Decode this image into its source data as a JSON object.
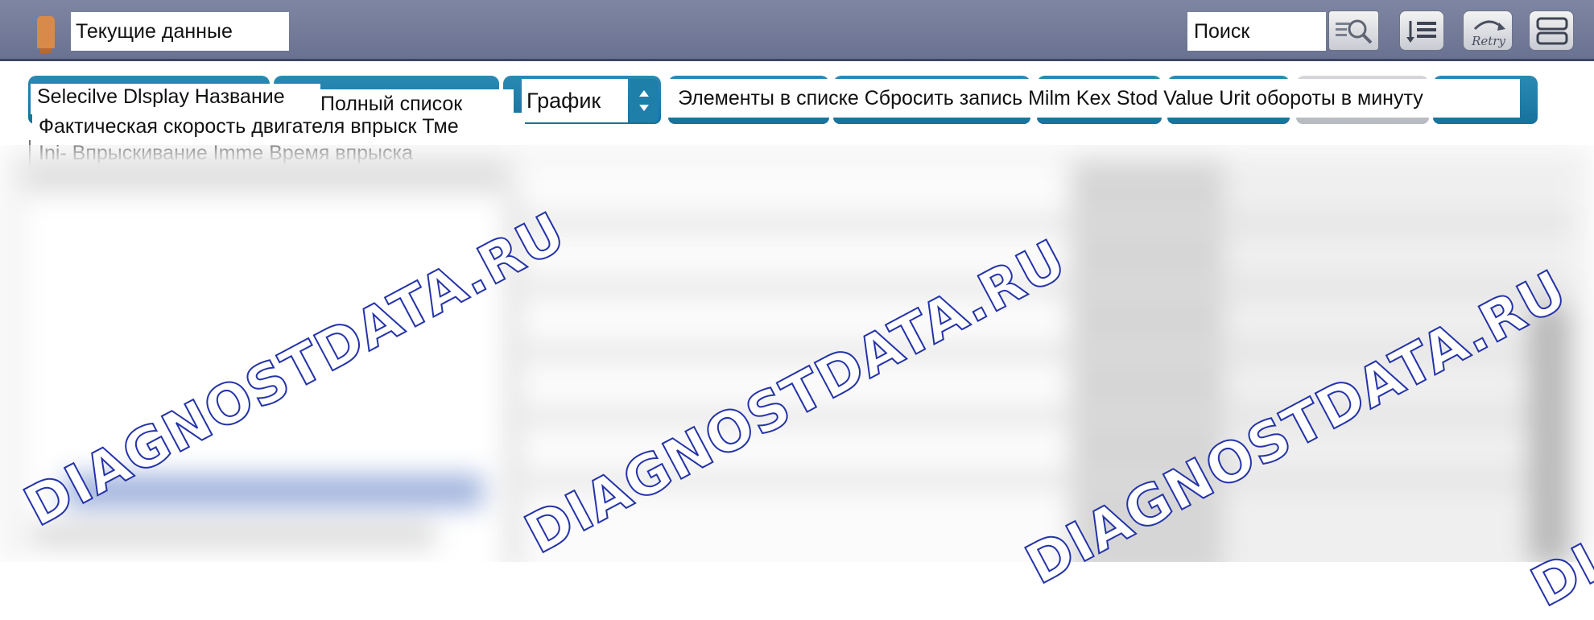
{
  "title_bar": {
    "title": "Текущие данные",
    "search_placeholder": "Поиск",
    "retry_label": "Retry"
  },
  "toolbar": {
    "selective_display": "Selecilve Dlsplay Название",
    "full_list": "Полный список",
    "graph": "График",
    "strip_text": "Элементы в списке Сбросить запись Milm Kex Stod Value Urit обороты в минуту"
  },
  "info": {
    "line1": "Фактическая скорость двигателя впрыск Тме",
    "line2": "Ini- Впрыскивание Imme Время впрыска"
  },
  "watermark": {
    "text": "DIAGNOSTDATA.RU",
    "color": "#2433a8"
  },
  "colors": {
    "title_bar": "#737b99",
    "tab_blue": "#1e7fa8",
    "tab_grey": "#c3c5ca"
  }
}
